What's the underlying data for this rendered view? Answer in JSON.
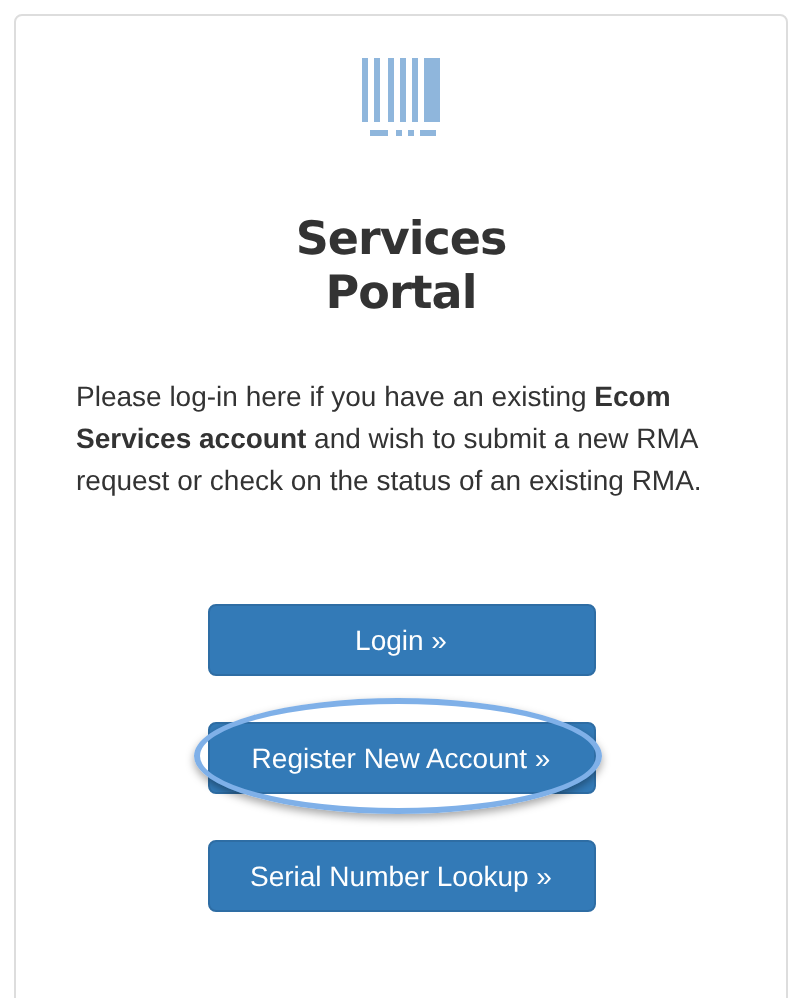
{
  "title": "Services Portal",
  "intro": "Please log-in here if you have an existing **Ecom Services account** and wish to submit a new RMA request or check on the status of an existing RMA.",
  "buttons": [
    {
      "label": "Login »",
      "highlighted": false
    },
    {
      "label": "Register New Account »",
      "highlighted": true
    },
    {
      "label": "Serial Number Lookup »",
      "highlighted": false
    }
  ]
}
